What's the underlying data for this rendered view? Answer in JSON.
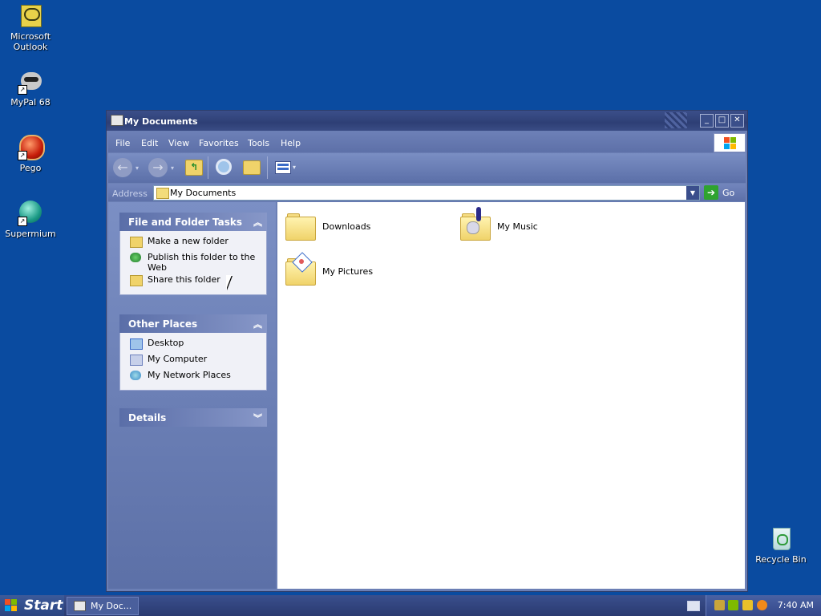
{
  "desktop": {
    "icons": [
      {
        "label": "Microsoft Outlook",
        "icon": "outlook-icon"
      },
      {
        "label": "MyPal 68",
        "icon": "mypal-raccoon-icon"
      },
      {
        "label": "Pego",
        "icon": "pego-red-ball-icon"
      },
      {
        "label": "Supermium",
        "icon": "supermium-icon"
      },
      {
        "label": "Recycle Bin",
        "icon": "recycle-bin-icon"
      }
    ]
  },
  "window": {
    "title": "My Documents",
    "menu": [
      "File",
      "Edit",
      "View",
      "Favorites",
      "Tools",
      "Help"
    ],
    "toolbar": {
      "back": "back-arrow-icon",
      "forward": "forward-arrow-icon",
      "up": "folder-up-icon",
      "search": "search-icon",
      "folders": "folders-icon",
      "views": "views-icon"
    },
    "address": {
      "label": "Address",
      "value": "My Documents",
      "go_label": "Go"
    },
    "tasks": {
      "file_folder": {
        "title": "File and Folder Tasks",
        "items": [
          "Make a new folder",
          "Publish this folder to the Web",
          "Share this folder"
        ]
      },
      "other_places": {
        "title": "Other Places",
        "items": [
          "Desktop",
          "My Computer",
          "My Network Places"
        ]
      },
      "details": {
        "title": "Details"
      }
    },
    "files": [
      {
        "name": "Downloads",
        "icon": "folder-icon"
      },
      {
        "name": "My Music",
        "icon": "music-folder-icon"
      },
      {
        "name": "My Pictures",
        "icon": "pictures-folder-icon"
      }
    ]
  },
  "taskbar": {
    "start_label": "Start",
    "task_button": "My Doc...",
    "clock": "7:40 AM"
  },
  "colors": {
    "desktop": "#0a4ba0",
    "title_bar": "#2e3f75",
    "task_pane": "#6b7fb5"
  }
}
